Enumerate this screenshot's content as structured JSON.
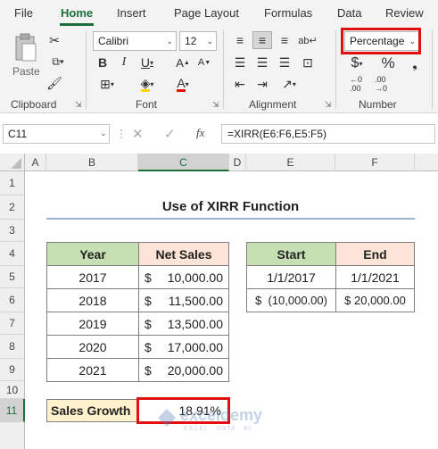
{
  "ribbon_tabs": [
    "File",
    "Home",
    "Insert",
    "Page Layout",
    "Formulas",
    "Data",
    "Review"
  ],
  "groups": {
    "clipboard": "Clipboard",
    "paste": "Paste",
    "font": "Font",
    "alignment": "Alignment",
    "number": "Number"
  },
  "font": {
    "name": "Calibri",
    "size": "12"
  },
  "number_format": "Percentage",
  "formula_bar": {
    "name_box": "C11",
    "fx": "fx",
    "formula": "=XIRR(E6:F6,E5:F5)"
  },
  "columns": [
    "A",
    "B",
    "C",
    "D",
    "E",
    "F"
  ],
  "rows": [
    "1",
    "2",
    "3",
    "4",
    "5",
    "6",
    "7",
    "8",
    "9",
    "10",
    "11"
  ],
  "selected": {
    "column": "C",
    "row": "11"
  },
  "sheet": {
    "title": "Use of XIRR Function",
    "table1": {
      "headers": [
        "Year",
        "Net Sales"
      ],
      "rows": [
        {
          "year": "2017",
          "sym": "$",
          "amount": "10,000.00"
        },
        {
          "year": "2018",
          "sym": "$",
          "amount": "11,500.00"
        },
        {
          "year": "2019",
          "sym": "$",
          "amount": "13,500.00"
        },
        {
          "year": "2020",
          "sym": "$",
          "amount": "17,000.00"
        },
        {
          "year": "2021",
          "sym": "$",
          "amount": "20,000.00"
        }
      ]
    },
    "table2": {
      "headers": [
        "Start",
        "End"
      ],
      "dates": [
        "1/1/2017",
        "1/1/2021"
      ],
      "values": [
        "$  (10,000.00)",
        "$ 20,000.00"
      ]
    },
    "result": {
      "label": "Sales Growth",
      "value": "18.91%"
    }
  },
  "watermark": {
    "brand": "exceldemy",
    "tagline": "EXCEL · DATA · BI"
  },
  "colors": {
    "accent": "#1e6e3c",
    "highlight_red": "#e01010",
    "header_green": "#c6e0b4",
    "header_peach": "#fce4d6",
    "result_label": "#fff2cc"
  }
}
